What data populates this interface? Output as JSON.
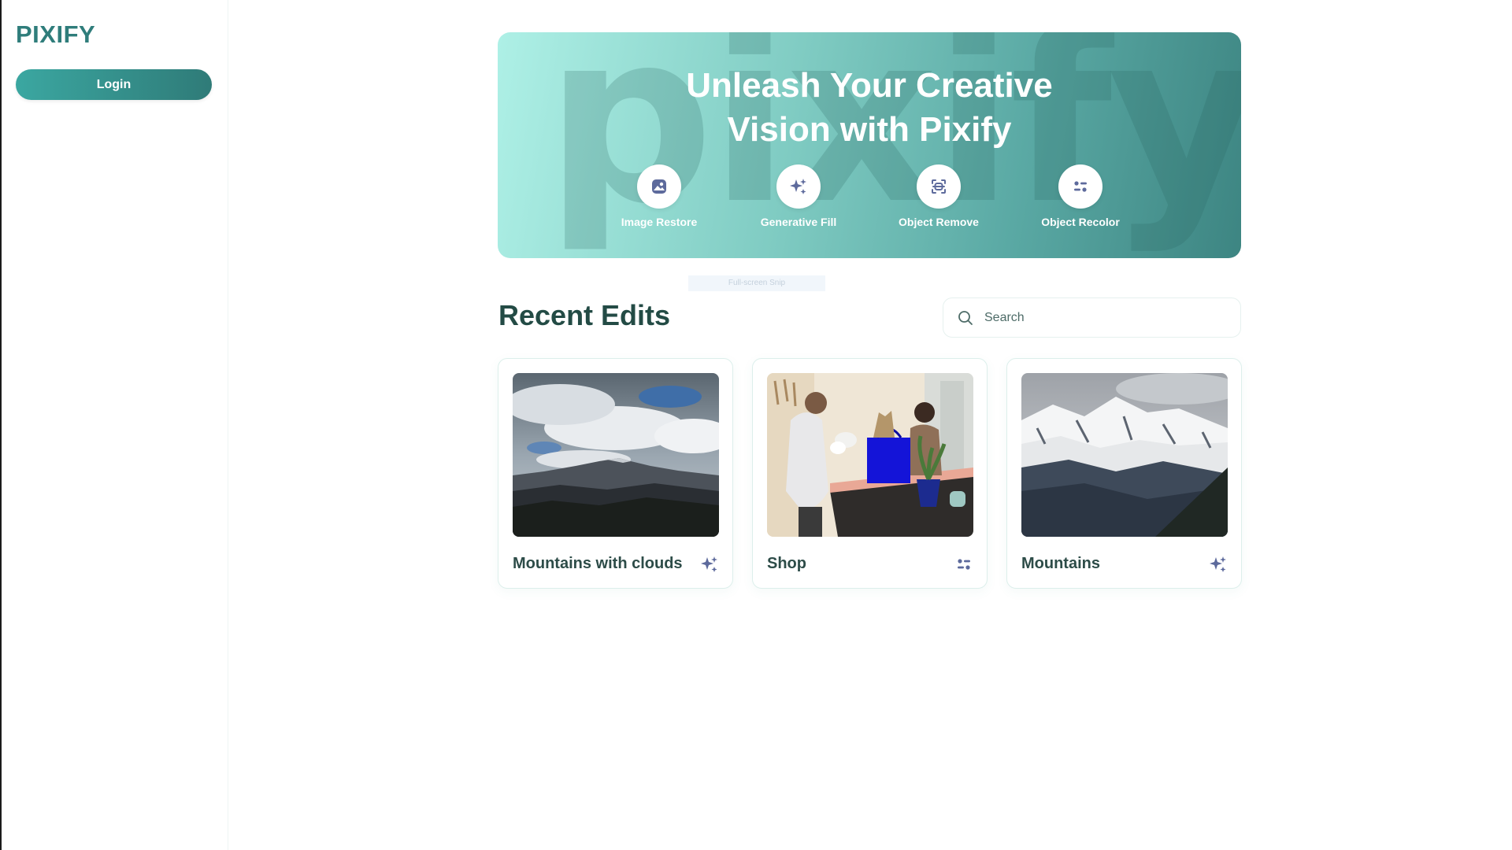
{
  "sidebar": {
    "brand": "PIXIFY",
    "login_label": "Login"
  },
  "hero": {
    "watermark": "pixify.",
    "title_line1": "Unleash Your Creative",
    "title_line2": "Vision with Pixify",
    "tools": [
      {
        "label": "Image Restore",
        "icon": "image-restore-icon"
      },
      {
        "label": "Generative Fill",
        "icon": "sparkles-icon"
      },
      {
        "label": "Object Remove",
        "icon": "scan-face-icon"
      },
      {
        "label": "Object Recolor",
        "icon": "recolor-toggle-icon"
      }
    ]
  },
  "snip_label": "Full-screen Snip",
  "recent": {
    "title": "Recent Edits",
    "search_placeholder": "Search",
    "items": [
      {
        "title": "Mountains with clouds",
        "icon": "sparkles-icon",
        "image": "mountains-clouds-thumbnail"
      },
      {
        "title": "Shop",
        "icon": "recolor-toggle-icon",
        "image": "shop-thumbnail"
      },
      {
        "title": "Mountains",
        "icon": "sparkles-icon",
        "image": "snowy-mountains-thumbnail"
      }
    ]
  },
  "colors": {
    "brand": "#2f7d7b",
    "accent_icon": "#5d6a9c",
    "heading": "#234b45"
  }
}
